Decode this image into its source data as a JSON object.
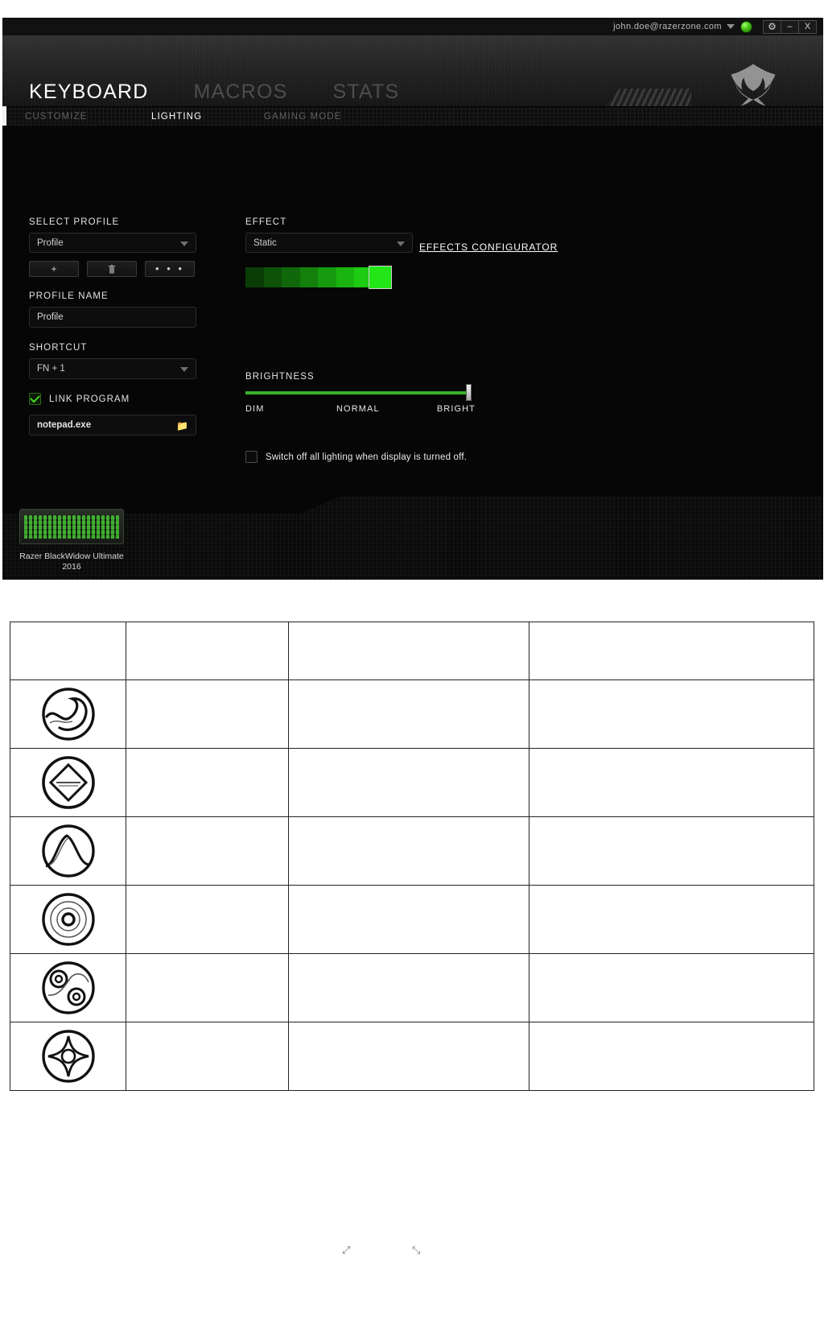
{
  "window": {
    "account_email": "john.doe@razerzone.com",
    "status_icon": "connected-orb",
    "settings_button": "gear-icon",
    "minimize_button": "–",
    "close_button": "X"
  },
  "main_nav": {
    "tabs": [
      {
        "label": "KEYBOARD",
        "active": true
      },
      {
        "label": "MACROS",
        "active": false
      },
      {
        "label": "STATS",
        "active": false
      }
    ],
    "logo": "razer-triple-snake-logo"
  },
  "sub_nav": {
    "tabs": [
      {
        "label": "CUSTOMIZE",
        "active": false
      },
      {
        "label": "LIGHTING",
        "active": true
      },
      {
        "label": "GAMING MODE",
        "active": false
      }
    ]
  },
  "profile_panel": {
    "select_profile_label": "SELECT PROFILE",
    "select_profile_value": "Profile",
    "add_button": "+",
    "delete_button": "trash-icon",
    "more_button": "• • •",
    "profile_name_label": "PROFILE NAME",
    "profile_name_value": "Profile",
    "shortcut_label": "SHORTCUT",
    "shortcut_value": "FN + 1",
    "link_program_label": "LINK PROGRAM",
    "link_program_checked": true,
    "linked_program_value": "notepad.exe",
    "browse_icon": "folder-icon"
  },
  "effect_panel": {
    "effect_label": "EFFECT",
    "effect_value": "Static",
    "effects_configurator_link": "EFFECTS CONFIGURATOR",
    "selected_color": "#23E618",
    "swatch_colors": [
      "#0a3d06",
      "#0d5207",
      "#10680a",
      "#14800c",
      "#179b0e",
      "#1ab410",
      "#1dcb13",
      "#20dd15",
      "#23e618"
    ],
    "brightness_label": "BRIGHTNESS",
    "brightness_value": 100,
    "brightness_ticks": [
      "DIM",
      "NORMAL",
      "BRIGHT"
    ],
    "switch_off_label": "Switch off all lighting when display is turned off.",
    "switch_off_checked": false
  },
  "device_footer": {
    "device_name_line1": "Razer BlackWidow Ultimate",
    "device_name_line2": "2016",
    "device_thumbnail": "keyboard-thumbnail"
  },
  "effects_table": {
    "rows": [
      {
        "icon": "",
        "b": "",
        "c": "",
        "d": ""
      },
      {
        "icon": "wave-icon",
        "b": "",
        "c": "",
        "d": ""
      },
      {
        "icon": "breathing-icon",
        "b": "",
        "c": "",
        "d": ""
      },
      {
        "icon": "spectrum-icon",
        "b": "",
        "c": "",
        "d": ""
      },
      {
        "icon": "ripple-icon",
        "b": "",
        "c": "",
        "d": ""
      },
      {
        "icon": "starlight-icon",
        "b": "",
        "c": "",
        "d": ""
      },
      {
        "icon": "reactive-icon",
        "b": "",
        "c": "",
        "d": ""
      }
    ]
  }
}
